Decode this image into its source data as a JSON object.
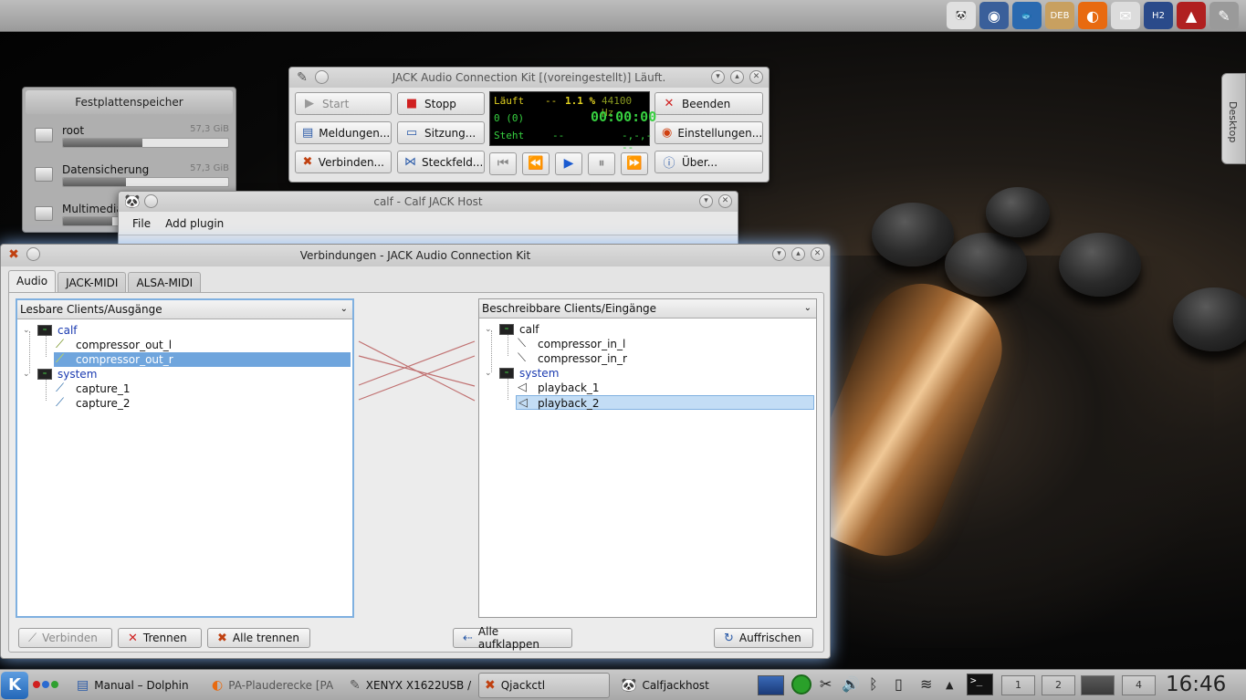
{
  "top_panel": {
    "tray_icons": [
      {
        "name": "panda-icon",
        "glyph": "🐼",
        "bg": "#e0e0e0"
      },
      {
        "name": "disc-icon",
        "glyph": "◉",
        "bg": "#3a5f9a"
      },
      {
        "name": "fish-icon",
        "glyph": "🐟",
        "bg": "#2a6ab0"
      },
      {
        "name": "deb-package-icon",
        "glyph": "DEB",
        "bg": "#c8a060"
      },
      {
        "name": "firefox-icon",
        "glyph": "◐",
        "bg": "#e86a10"
      },
      {
        "name": "mail-icon",
        "glyph": "✉",
        "bg": "#dcdcdc"
      },
      {
        "name": "h2-icon",
        "glyph": "H2",
        "bg": "#2a4a8a"
      },
      {
        "name": "ardour-icon",
        "glyph": "▲",
        "bg": "#b02020"
      },
      {
        "name": "pencil-icon",
        "glyph": "✎",
        "bg": "#9a9a9a"
      }
    ]
  },
  "desktop": {
    "tab_label": "Desktop"
  },
  "disk_widget": {
    "title": "Festplattenspeicher",
    "disks": [
      {
        "label": "root",
        "size": "57,3 GiB",
        "fill": 0.48
      },
      {
        "label": "Datensicherung",
        "size": "57,3 GiB",
        "fill": 0.38
      },
      {
        "label": "Multimedia",
        "size": "",
        "fill": 0.3
      }
    ]
  },
  "qjackctl": {
    "title": "JACK Audio Connection Kit [(voreingestellt)] Läuft.",
    "buttons": {
      "start": "Start",
      "stop": "Stopp",
      "quit": "Beenden",
      "messages": "Meldungen...",
      "session": "Sitzung...",
      "setup": "Einstellungen...",
      "connect": "Verbinden...",
      "patchbay": "Steckfeld...",
      "about": "Über..."
    },
    "lcd": {
      "state": "Läuft",
      "dash1": "--",
      "dsp": "1.1 %",
      "rate": "44100 Hz",
      "xruns": "0 (0)",
      "time": "00:00:00",
      "transport": "Steht",
      "dash2": "--",
      "dash3": "-,-,---"
    }
  },
  "calf": {
    "title": "calf - Calf JACK Host",
    "menu": [
      "File",
      "Add plugin"
    ]
  },
  "connections": {
    "title": "Verbindungen - JACK Audio Connection Kit",
    "tabs": [
      "Audio",
      "JACK-MIDI",
      "ALSA-MIDI"
    ],
    "readable": {
      "header": "Lesbare Clients/Ausgänge",
      "clients": [
        {
          "name": "calf",
          "ports": [
            "compressor_out_l",
            "compressor_out_r"
          ]
        },
        {
          "name": "system",
          "ports": [
            "capture_1",
            "capture_2"
          ]
        }
      ]
    },
    "writable": {
      "header": "Beschreibbare Clients/Eingänge",
      "clients": [
        {
          "name": "calf",
          "ports": [
            "compressor_in_l",
            "compressor_in_r"
          ]
        },
        {
          "name": "system",
          "ports": [
            "playback_1",
            "playback_2"
          ]
        }
      ]
    },
    "buttons": {
      "connect": "Verbinden",
      "disconnect": "Trennen",
      "disconnect_all": "Alle trennen",
      "expand_all": "Alle aufklappen",
      "refresh": "Auffrischen"
    }
  },
  "taskbar": {
    "tasks": [
      "Manual – Dolphin",
      "PA-Plauderecke [PA]",
      "XENYX X1622USB / ...",
      "Qjackctl",
      "Calfjackhost"
    ],
    "pager": [
      "1",
      "2",
      "",
      "4"
    ],
    "clock": "16:46"
  }
}
